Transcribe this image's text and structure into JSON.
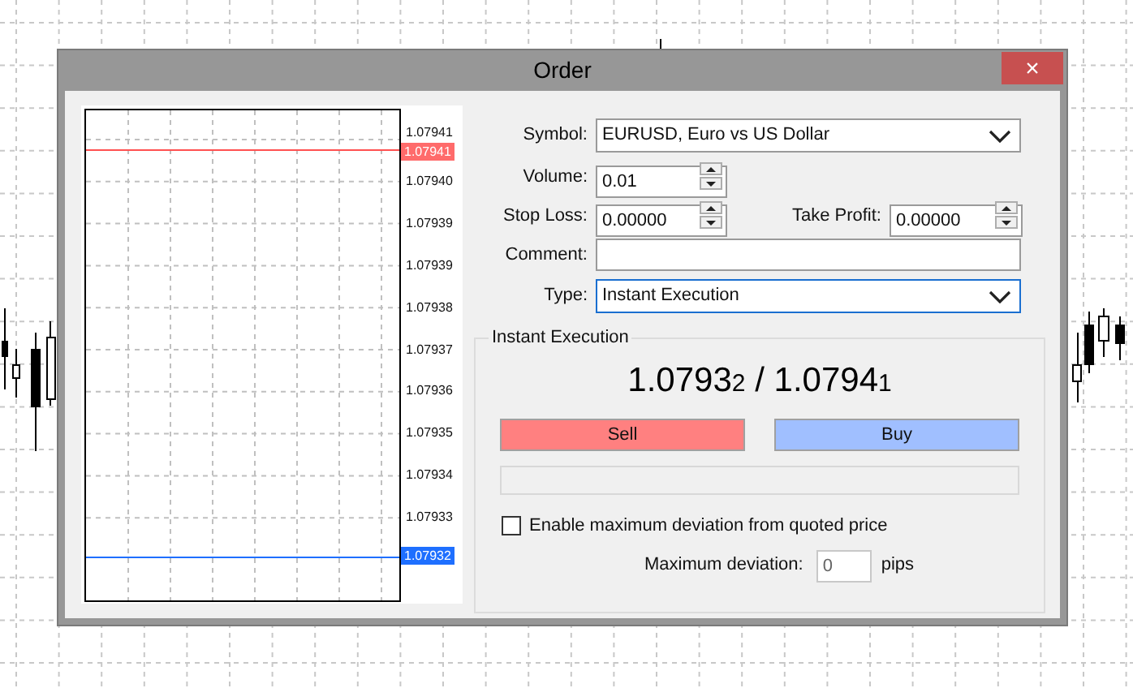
{
  "window": {
    "title": "Order",
    "close": "×"
  },
  "tick_chart": {
    "price_labels": [
      "1.07941",
      "1.07940",
      "1.07939",
      "1.07939",
      "1.07938",
      "1.07937",
      "1.07936",
      "1.07935",
      "1.07934",
      "1.07933"
    ],
    "ask_label": "1.07941",
    "bid_label": "1.07932"
  },
  "form": {
    "symbol": {
      "label": "Symbol:",
      "value": "EURUSD, Euro vs US Dollar"
    },
    "volume": {
      "label": "Volume:",
      "value": "0.01"
    },
    "stop_loss": {
      "label": "Stop Loss:",
      "value": "0.00000"
    },
    "take_profit": {
      "label": "Take Profit:",
      "value": "0.00000"
    },
    "comment": {
      "label": "Comment:"
    },
    "type": {
      "label": "Type:",
      "value": "Instant Execution",
      "focused": true
    }
  },
  "execution": {
    "title": "Instant Execution",
    "bid": {
      "main": "1.0793",
      "small": "2"
    },
    "separator": "/",
    "ask": {
      "main": "1.0794",
      "small": "1"
    },
    "sell_button": "Sell",
    "buy_button": "Buy",
    "deviation_checkbox": {
      "label": "Enable maximum deviation from quoted price",
      "checked": false
    },
    "max_deviation": {
      "label": "Maximum deviation:",
      "value": "0",
      "unit": "pips"
    }
  }
}
